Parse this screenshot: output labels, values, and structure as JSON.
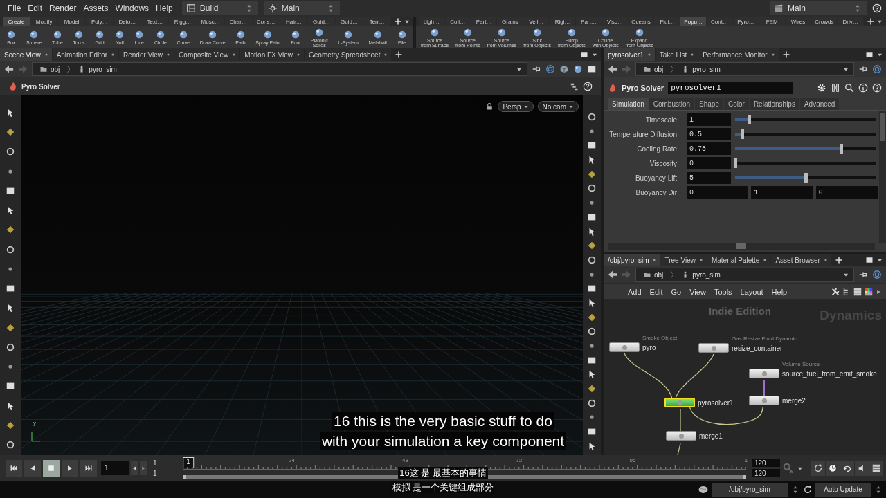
{
  "menu_bar": {
    "menus": [
      "File",
      "Edit",
      "Render",
      "Assets",
      "Windows",
      "Help"
    ],
    "desktop": "Build",
    "viewport_layout": "Main",
    "right_desktop": "Main"
  },
  "left_shelf": {
    "tabs": [
      {
        "label": "Create",
        "selected": true
      },
      {
        "label": "Modify",
        "selected": false
      },
      {
        "label": "Model",
        "selected": false
      },
      {
        "label": "Poly…",
        "selected": false
      },
      {
        "label": "Defo…",
        "selected": false
      },
      {
        "label": "Text…",
        "selected": false
      },
      {
        "label": "Rigg…",
        "selected": false
      },
      {
        "label": "Musc…",
        "selected": false
      },
      {
        "label": "Char…",
        "selected": false
      },
      {
        "label": "Cons…",
        "selected": false
      },
      {
        "label": "Hair…",
        "selected": false
      },
      {
        "label": "Guid…",
        "selected": false
      },
      {
        "label": "Guid…",
        "selected": false
      },
      {
        "label": "Terr…",
        "selected": false
      }
    ],
    "tools": [
      "Box",
      "Sphere",
      "Tube",
      "Torus",
      "Grid",
      "Null",
      "Line",
      "Circle",
      "Curve",
      "Draw Curve",
      "Path",
      "Spray Paint",
      "Font",
      "Platonic\nSolids",
      "L-System",
      "Metaball",
      "File"
    ]
  },
  "right_shelf": {
    "tabs": [
      {
        "label": "Ligh…",
        "selected": false
      },
      {
        "label": "Coll…",
        "selected": false
      },
      {
        "label": "Part…",
        "selected": false
      },
      {
        "label": "Grains",
        "selected": false
      },
      {
        "label": "Vell…",
        "selected": false
      },
      {
        "label": "Rigi…",
        "selected": false
      },
      {
        "label": "Part…",
        "selected": false
      },
      {
        "label": "Visc…",
        "selected": false
      },
      {
        "label": "Oceans",
        "selected": false
      },
      {
        "label": "Flui…",
        "selected": false
      },
      {
        "label": "Popu…",
        "selected": true
      },
      {
        "label": "Cont…",
        "selected": false
      },
      {
        "label": "Pyro…",
        "selected": false
      },
      {
        "label": "FEM",
        "selected": false
      },
      {
        "label": "Wires",
        "selected": false
      },
      {
        "label": "Crowds",
        "selected": false
      },
      {
        "label": "Driv…",
        "selected": false
      }
    ],
    "tools": [
      "Source\nfrom Surface",
      "Source\nfrom Points",
      "Source\nfrom Volumes",
      "Sink\nfrom Objects",
      "Pump\nfrom Objects",
      "Collide\nwith Objects",
      "Expand\nfrom Objects"
    ]
  },
  "viewer": {
    "tabs": [
      {
        "label": "Scene View",
        "selected": true
      },
      {
        "label": "Animation Editor",
        "selected": false
      },
      {
        "label": "Render View",
        "selected": false
      },
      {
        "label": "Composite View",
        "selected": false
      },
      {
        "label": "Motion FX View",
        "selected": false
      },
      {
        "label": "Geometry Spreadsheet",
        "selected": false
      }
    ],
    "path": [
      "obj",
      "pyro_sim"
    ],
    "title": "Pyro Solver",
    "camera_buttons": [
      "Persp",
      "No cam"
    ],
    "axis_label": "y"
  },
  "parameters": {
    "tabs": [
      {
        "label": "pyrosolver1",
        "selected": true
      },
      {
        "label": "Take List",
        "selected": false
      },
      {
        "label": "Performance Monitor",
        "selected": false
      }
    ],
    "path": [
      "obj",
      "pyro_sim"
    ],
    "node_type": "Pyro Solver",
    "node_name": "pyrosolver1",
    "param_tabs": [
      {
        "label": "Simulation",
        "selected": true
      },
      {
        "label": "Combustion",
        "selected": false
      },
      {
        "label": "Shape",
        "selected": false
      },
      {
        "label": "Color",
        "selected": false
      },
      {
        "label": "Relationships",
        "selected": false
      },
      {
        "label": "Advanced",
        "selected": false
      }
    ],
    "params": [
      {
        "kind": "slider",
        "label": "Timescale",
        "value": "1",
        "level": 0.1
      },
      {
        "kind": "slider",
        "label": "Temperature Diffusion",
        "value": "0.5",
        "level": 0.05
      },
      {
        "kind": "slider",
        "label": "Cooling Rate",
        "value": "0.75",
        "level": 0.75
      },
      {
        "kind": "slider",
        "label": "Viscosity",
        "value": "0",
        "level": 0
      },
      {
        "kind": "slider",
        "label": "Buoyancy Lift",
        "value": "5",
        "level": 0.5
      },
      {
        "kind": "vector",
        "label": "Buoyancy Dir",
        "values": [
          "0",
          "1",
          "0"
        ]
      }
    ]
  },
  "network": {
    "tabs": [
      {
        "label": "/obj/pyro_sim",
        "selected": true
      },
      {
        "label": "Tree View",
        "selected": false
      },
      {
        "label": "Material Palette",
        "selected": false
      },
      {
        "label": "Asset Browser",
        "selected": false
      }
    ],
    "path": [
      "obj",
      "pyro_sim"
    ],
    "menus": [
      "Add",
      "Edit",
      "Go",
      "View",
      "Tools",
      "Layout",
      "Help"
    ],
    "edition": "Indie Edition",
    "context": "Dynamics",
    "nodes": [
      {
        "name": "pyro",
        "type_label": "Smoke Object",
        "selected": false
      },
      {
        "name": "resize_container",
        "type_label": "Gas Resize Fluid Dynamic",
        "selected": false
      },
      {
        "name": "source_fuel_from_emit_smoke",
        "type_label": "Volume Source",
        "selected": false
      },
      {
        "name": "merge2",
        "selected": false
      },
      {
        "name": "pyrosolver1",
        "selected": true
      },
      {
        "name": "merge1",
        "selected": false
      }
    ]
  },
  "timeline": {
    "transport": [
      {
        "kind": "first",
        "selected": false
      },
      {
        "kind": "back",
        "selected": false
      },
      {
        "kind": "stop",
        "selected": true
      },
      {
        "kind": "play",
        "selected": false
      },
      {
        "kind": "last",
        "selected": false
      }
    ],
    "frame": "1",
    "start": "1",
    "range_start": "1",
    "ticks": [
      "24",
      "48",
      "72",
      "96",
      "1"
    ],
    "current_marker": "1",
    "end": "120",
    "range_end": "120"
  },
  "status_bar": {
    "path": "/obj/pyro_sim",
    "update_mode": "Auto Update"
  },
  "subtitles": {
    "english": [
      "16 this is the very basic stuff to do",
      "with your simulation a key component"
    ],
    "chinese": [
      "16这 是 最基本的事情",
      "模拟 是一个关键组成部分"
    ]
  }
}
